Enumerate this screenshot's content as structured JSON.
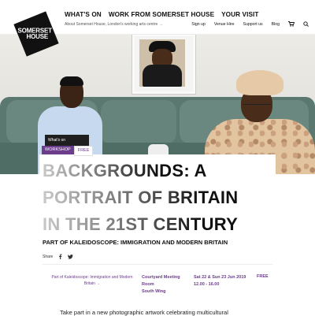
{
  "header": {
    "logo_lines": [
      "SOMERSET",
      "HOUSE"
    ],
    "main_nav": [
      "WHAT'S ON",
      "WORK FROM SOMERSET HOUSE",
      "YOUR VISIT"
    ],
    "sub_nav": "About Somerset House, London's working arts centre →",
    "right_nav": [
      "Sign up",
      "Venue Hire",
      "Support us",
      "Blog"
    ],
    "icons": [
      "cart-icon",
      "search-icon"
    ]
  },
  "event": {
    "breadcrumb": "What's on",
    "type_tag": "WORKSHOP",
    "price_tag": "FREE",
    "title_line1_a": "BACKGROUNDS",
    "title_line1_b": ": A",
    "title_line2": "PORTRAIT OF BRITAIN",
    "title_line3": "IN THE 21ST CENTURY",
    "subtitle": "PART OF KALEIDOSCOPE: IMMIGRATION AND MODERN BRITAIN",
    "share_label": "Share",
    "share_icons": [
      "facebook-icon",
      "twitter-icon"
    ],
    "series_link": "Part of Kaleidoscope: Immigration and Modern Britain →",
    "venue_line1": "Courtyard Meeting",
    "venue_line2": "Room",
    "venue_line3": "South Wing",
    "date_line1": "Sat 22 & Sun 23 Jun 2019",
    "date_line2": "12.00 - 16.00",
    "price": "FREE",
    "body_start": "Take part in a new photographic artwork celebrating multicultural"
  },
  "colors": {
    "accent": "#6b3d8a",
    "text": "#111111",
    "tag_dark": "#1f1f1f"
  }
}
